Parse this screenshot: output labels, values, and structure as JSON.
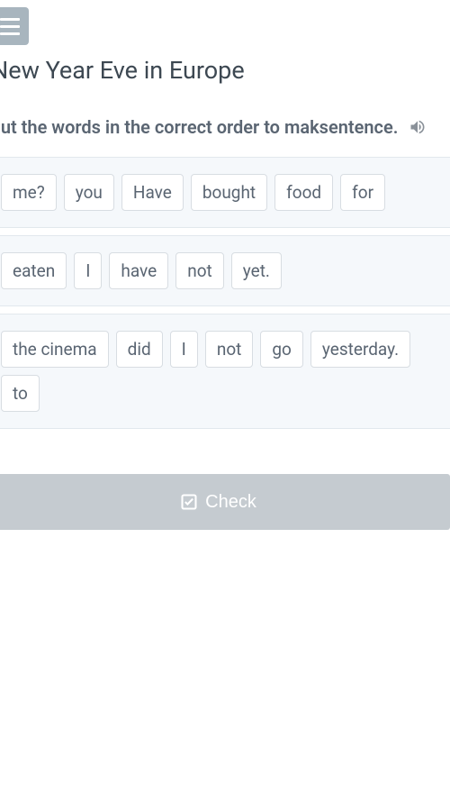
{
  "menu": {
    "name": "menu-icon"
  },
  "title": "New Year Eve in Europe",
  "instruction": {
    "text1": "Put the words in the correct order to mak",
    "text2": "sentence."
  },
  "rows": [
    {
      "words": [
        "me?",
        "you",
        "Have",
        "bought",
        "food",
        "for"
      ]
    },
    {
      "words": [
        "eaten",
        "I",
        "have",
        "not",
        "yet."
      ]
    },
    {
      "words": [
        "the cinema",
        "did",
        "I",
        "not",
        "go",
        "yesterday.",
        "to"
      ]
    }
  ],
  "checkButton": {
    "label": "Check"
  }
}
